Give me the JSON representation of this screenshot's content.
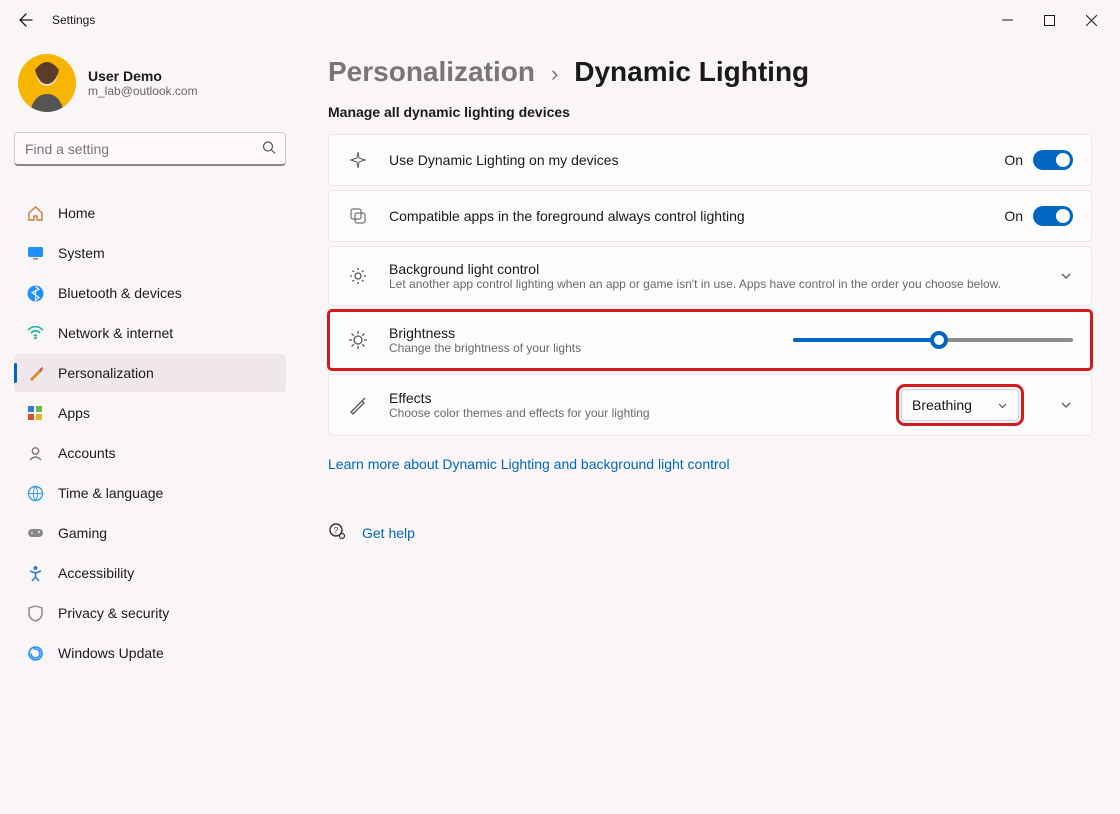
{
  "app": {
    "title": "Settings"
  },
  "user": {
    "name": "User Demo",
    "email": "m_lab@outlook.com"
  },
  "search": {
    "placeholder": "Find a setting"
  },
  "nav": {
    "items": [
      {
        "label": "Home"
      },
      {
        "label": "System"
      },
      {
        "label": "Bluetooth & devices"
      },
      {
        "label": "Network & internet"
      },
      {
        "label": "Personalization"
      },
      {
        "label": "Apps"
      },
      {
        "label": "Accounts"
      },
      {
        "label": "Time & language"
      },
      {
        "label": "Gaming"
      },
      {
        "label": "Accessibility"
      },
      {
        "label": "Privacy & security"
      },
      {
        "label": "Windows Update"
      }
    ]
  },
  "breadcrumb": {
    "parent": "Personalization",
    "current": "Dynamic Lighting"
  },
  "section_subtitle": "Manage all dynamic lighting devices",
  "cards": {
    "dynamic_toggle": {
      "title": "Use Dynamic Lighting on my devices",
      "state": "On"
    },
    "foreground_toggle": {
      "title": "Compatible apps in the foreground always control lighting",
      "state": "On"
    },
    "background": {
      "title": "Background light control",
      "desc": "Let another app control lighting when an app or game isn't in use. Apps have control in the order you choose below."
    },
    "brightness": {
      "title": "Brightness",
      "desc": "Change the brightness of your lights",
      "value_percent": 52
    },
    "effects": {
      "title": "Effects",
      "desc": "Choose color themes and effects for your lighting",
      "selected": "Breathing"
    }
  },
  "links": {
    "learn_more": "Learn more about Dynamic Lighting and background light control",
    "get_help": "Get help"
  }
}
